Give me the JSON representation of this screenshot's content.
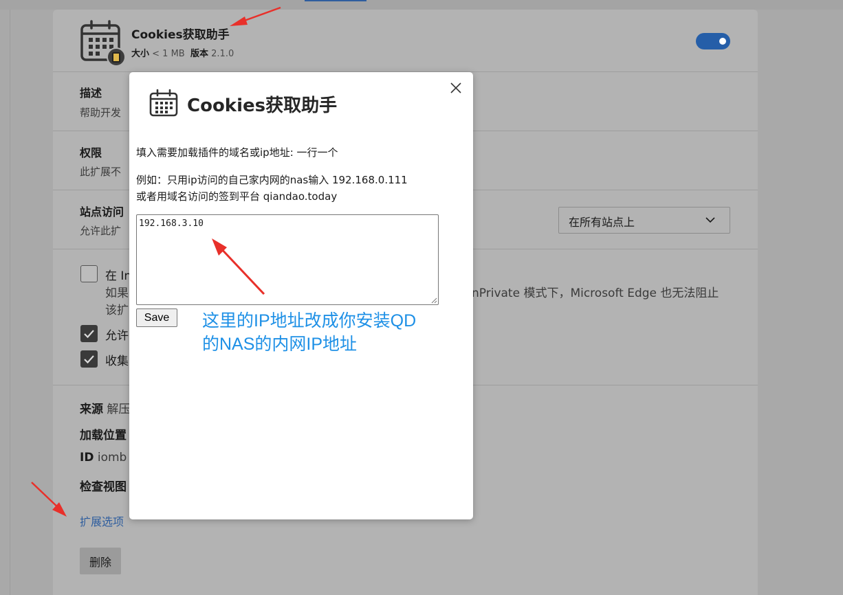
{
  "extension": {
    "name": "Cookies获取助手",
    "size_label": "大小",
    "size_value": "< 1 MB",
    "version_label": "版本",
    "version_value": "2.1.0",
    "enabled": true
  },
  "sections": {
    "description": {
      "title": "描述",
      "text": "帮助开发"
    },
    "permissions": {
      "title": "权限",
      "text": "此扩展不"
    },
    "site_access": {
      "title": "站点访问",
      "text": "允许此扩",
      "select_value": "在所有站点上"
    }
  },
  "options": [
    {
      "text": "在 In",
      "checked": false,
      "sub1": "如果",
      "sub2": "该扩"
    },
    {
      "text": "允许",
      "checked": true
    },
    {
      "text": "收集",
      "checked": true
    }
  ],
  "inprivate_text": "nPrivate 模式下，Microsoft Edge 也无法阻止",
  "info": {
    "source_label": "来源",
    "source_value": "解压",
    "location_label": "加载位置",
    "id_label": "ID",
    "id_value": "iomb",
    "inspect_label": "检查视图"
  },
  "ext_options_link": "扩展选项",
  "remove_button": "删除",
  "dialog": {
    "title": "Cookies获取助手",
    "line1": "填入需要加载插件的域名或ip地址: 一行一个",
    "line2": "例如：只用ip访问的自己家内网的nas输入 192.168.0.111",
    "line3": "或者用域名访问的签到平台 qiandao.today",
    "textarea_value": "192.168.3.10",
    "save_label": "Save",
    "annotation1": "这里的IP地址改成你安装QD",
    "annotation2": "的NAS的内网IP地址"
  },
  "colors": {
    "accent": "#255ea8",
    "annotation": "#1e90e6",
    "arrow": "#e8302a",
    "link": "#2f5e9e"
  }
}
